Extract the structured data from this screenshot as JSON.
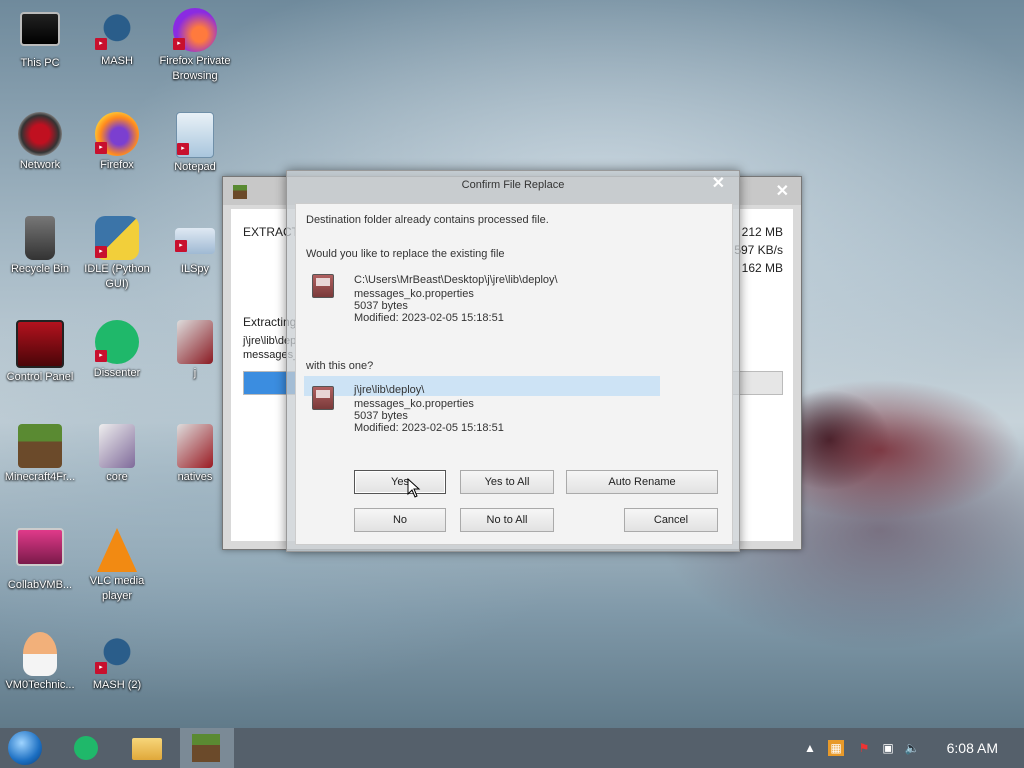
{
  "desktop": {
    "icons": [
      {
        "label": "This PC"
      },
      {
        "label": "MASH"
      },
      {
        "label": "Firefox Private Browsing"
      },
      {
        "label": "Network"
      },
      {
        "label": "Firefox"
      },
      {
        "label": "Notepad"
      },
      {
        "label": "Recycle Bin"
      },
      {
        "label": "IDLE (Python GUI)"
      },
      {
        "label": "ILSpy"
      },
      {
        "label": "Control Panel"
      },
      {
        "label": "Dissenter"
      },
      {
        "label": "j"
      },
      {
        "label": "Minecraft4Fr..."
      },
      {
        "label": "core"
      },
      {
        "label": "natives"
      },
      {
        "label": "CollabVMB..."
      },
      {
        "label": "VLC media player"
      },
      {
        "label": "VM0Technic..."
      },
      {
        "label": "MASH (2)"
      }
    ]
  },
  "extract_window": {
    "status": "EXTRACTING",
    "size_total": "212 MB",
    "speed": "597 KB/s",
    "size_done": "162 MB",
    "extracting_label": "Extracting",
    "path_line1": "j\\jre\\lib\\deploy\\",
    "path_line2": "messages_ko.properties",
    "progress_fraction": 0.19
  },
  "dialog": {
    "title": "Confirm File Replace",
    "line1": "Destination folder already contains processed file.",
    "question": "Would you like to replace the existing file",
    "existing": {
      "path": "C:\\Users\\MrBeast\\Desktop\\j\\jre\\lib\\deploy\\",
      "name": "messages_ko.properties",
      "size": "5037 bytes",
      "modified": "Modified: 2023-02-05 15:18:51"
    },
    "with_this": "with this one?",
    "incoming": {
      "path": "j\\jre\\lib\\deploy\\",
      "name": "messages_ko.properties",
      "size": "5037 bytes",
      "modified": "Modified: 2023-02-05 15:18:51"
    },
    "buttons": {
      "yes": "Yes",
      "yes_all": "Yes to All",
      "auto_rename": "Auto Rename",
      "no": "No",
      "no_all": "No to All",
      "cancel": "Cancel"
    }
  },
  "taskbar": {
    "clock": "6:08 AM"
  },
  "colors": {
    "accent": "#3b8de0",
    "taskbar": "#55606b"
  }
}
